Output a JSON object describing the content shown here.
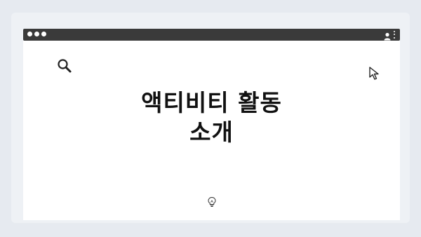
{
  "page": {
    "heading_line1": "액티비티 활동",
    "heading_line2": "소개"
  },
  "icons": {
    "window_controls": "traffic-dots",
    "account": "user-icon",
    "menu": "kebab-menu-icon",
    "search": "search-icon",
    "cursor": "cursor-icon",
    "idea": "lightbulb-icon"
  },
  "colors": {
    "background": "#e6eaf0",
    "titlebar": "#3a3a3a",
    "content": "#ffffff",
    "text": "#111111"
  }
}
